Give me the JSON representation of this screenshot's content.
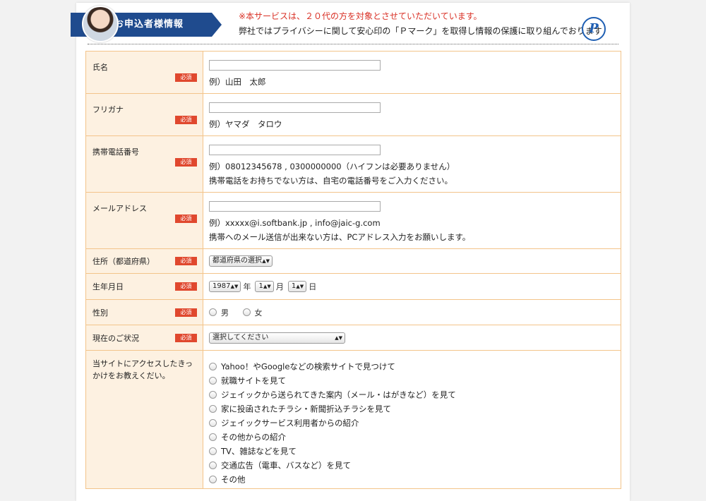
{
  "header": {
    "title": "お申込者様情報",
    "notice_red": "※本サービスは、２０代の方を対象とさせていただいています。",
    "notice_black": "弊社ではプライバシーに関して安心印の「Ｐマーク」を取得し情報の保護に取り組んでおります",
    "pmark_letter": "P"
  },
  "required_badge": "必須",
  "fields": {
    "name": {
      "label": "氏名",
      "value": "",
      "hint": "例）山田　太郎"
    },
    "furigana": {
      "label": "フリガナ",
      "value": "",
      "hint": "例）ヤマダ　タロウ"
    },
    "phone": {
      "label": "携帯電話番号",
      "value": "",
      "hint1": "例）08012345678 , 0300000000（ハイフンは必要ありません）",
      "hint2": "携帯電話をお持ちでない方は、自宅の電話番号をご入力ください。"
    },
    "email": {
      "label": "メールアドレス",
      "value": "",
      "hint1": "例）xxxxx@i.softbank.jp , info@jaic-g.com",
      "hint2": "携帯へのメール送信が出来ない方は、PCアドレス入力をお願いします。"
    },
    "prefecture": {
      "label": "住所（都道府県）",
      "selected": "都道府県の選択"
    },
    "birthdate": {
      "label": "生年月日",
      "year": "1987",
      "year_unit": "年",
      "month": "1",
      "month_unit": "月",
      "day": "1",
      "day_unit": "日"
    },
    "gender": {
      "label": "性別",
      "options": [
        "男",
        "女"
      ]
    },
    "status": {
      "label": "現在のご状況",
      "selected": "選択してください"
    },
    "source": {
      "label": "当サイトにアクセスしたきっかけをお教えくだい。",
      "options": [
        "Yahoo！やGoogleなどの検索サイトで見つけて",
        "就職サイトを見て",
        "ジェイックから送られてきた案内（メール・はがきなど）を見て",
        "家に投函されたチラシ・新聞折込チラシを見て",
        "ジェイックサービス利用者からの紹介",
        "その他からの紹介",
        "TV、雑誌などを見て",
        "交通広告（電車、バスなど）を見て",
        "その他"
      ]
    }
  },
  "colors": {
    "banner": "#1f4b8e",
    "label_bg": "#fdf1e1",
    "border": "#f3c48a",
    "required": "#e0482e",
    "notice": "#d93025"
  }
}
